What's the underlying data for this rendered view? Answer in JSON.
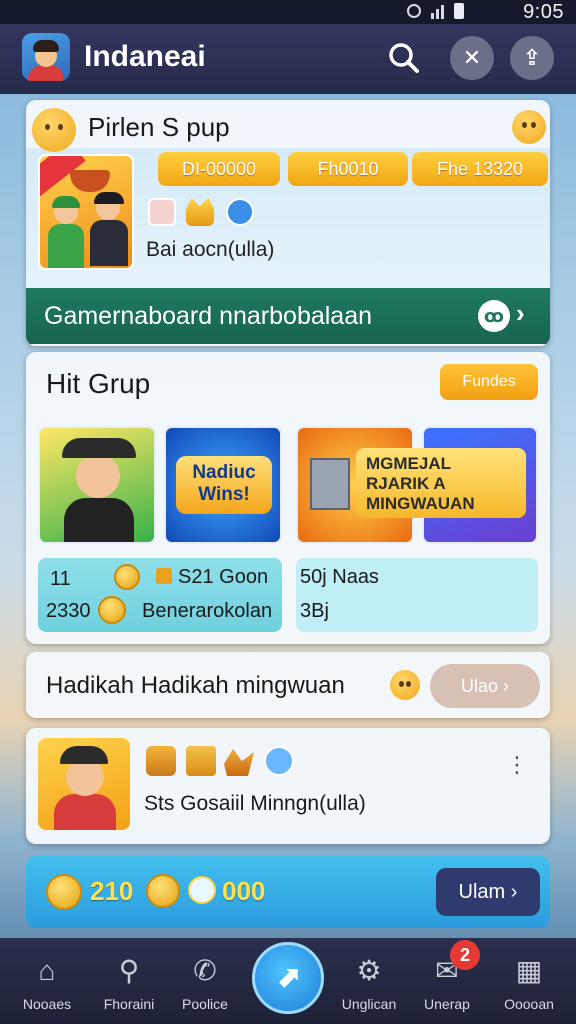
{
  "status_bar": {
    "time": "9:05"
  },
  "header": {
    "title": "Indaneai",
    "icons": [
      "avatar",
      "search-icon",
      "tools-icon",
      "share-icon"
    ]
  },
  "card1": {
    "title": "Pirlen S pup",
    "pills": [
      "DI-00000",
      "Fh0010",
      "Fhe 13320"
    ],
    "subtitle": "Bai aocn(ulla)",
    "bar_label": "Gamernaboard nnarbobalaan"
  },
  "card2": {
    "title": "Hit Grup",
    "button": "Fundes",
    "tile2_text": "Nadiuc Wins!",
    "banner_text": "MGMEJAL RJARIK A MINGWAUAN",
    "stats_left": {
      "row1_value": "11",
      "row2_value": "2330",
      "row1_label": "S21 Goon",
      "row2_label": "Benerarokolan"
    },
    "stats_right": {
      "row1": "50j Naas",
      "row2": "3Bj"
    }
  },
  "card3": {
    "title": "Hadikah Hadikah mingwuan",
    "button": "Ulao"
  },
  "card4": {
    "text": "Sts Gosaiil Minngn(ulla)"
  },
  "promo": {
    "coin_value": "210",
    "second_value": "000",
    "button": "Ulam"
  },
  "nav": {
    "items": [
      "Nooaes",
      "Fhoraini",
      "Poolice",
      "Unglican",
      "Unerap",
      "Ooooan"
    ],
    "badge": "2"
  },
  "colors": {
    "header_bg": "#2c3054",
    "pill": "#f7b21f",
    "bar_green": "#1b6e58",
    "nav_bg": "#242842",
    "fab": "#2b9be8"
  }
}
